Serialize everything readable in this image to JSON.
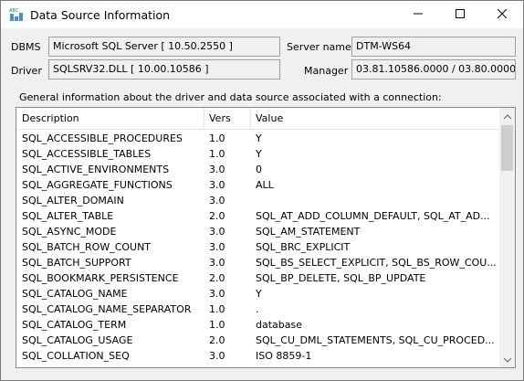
{
  "window": {
    "title": "Data Source Information"
  },
  "info": {
    "dbms_label": "DBMS",
    "dbms_value": "Microsoft SQL Server [ 10.50.2550 ]",
    "driver_label": "Driver",
    "driver_value": "SQLSRV32.DLL [ 10.00.10586 ]",
    "server_label": "Server name",
    "server_value": "DTM-WS64",
    "manager_label": "Manager",
    "manager_value": "03.81.10586.0000 / 03.80.0000"
  },
  "description": "General information about the driver and data source associated with a connection:",
  "list": {
    "columns": [
      "Description",
      "Vers",
      "Value"
    ],
    "rows": [
      [
        "SQL_ACCESSIBLE_PROCEDURES",
        "1.0",
        "Y"
      ],
      [
        "SQL_ACCESSIBLE_TABLES",
        "1.0",
        "Y"
      ],
      [
        "SQL_ACTIVE_ENVIRONMENTS",
        "3.0",
        "0"
      ],
      [
        "SQL_AGGREGATE_FUNCTIONS",
        "3.0",
        "ALL"
      ],
      [
        "SQL_ALTER_DOMAIN",
        "3.0",
        ""
      ],
      [
        "SQL_ALTER_TABLE",
        "2.0",
        "SQL_AT_ADD_COLUMN_DEFAULT, SQL_AT_AD..."
      ],
      [
        "SQL_ASYNC_MODE",
        "3.0",
        "SQL_AM_STATEMENT"
      ],
      [
        "SQL_BATCH_ROW_COUNT",
        "3.0",
        "SQL_BRC_EXPLICIT"
      ],
      [
        "SQL_BATCH_SUPPORT",
        "3.0",
        "SQL_BS_SELECT_EXPLICIT, SQL_BS_ROW_COU..."
      ],
      [
        "SQL_BOOKMARK_PERSISTENCE",
        "2.0",
        "SQL_BP_DELETE, SQL_BP_UPDATE"
      ],
      [
        "SQL_CATALOG_NAME",
        "3.0",
        "Y"
      ],
      [
        "SQL_CATALOG_NAME_SEPARATOR",
        "1.0",
        "."
      ],
      [
        "SQL_CATALOG_TERM",
        "1.0",
        "database"
      ],
      [
        "SQL_CATALOG_USAGE",
        "2.0",
        "SQL_CU_DML_STATEMENTS, SQL_CU_PROCED..."
      ],
      [
        "SQL_COLLATION_SEQ",
        "3.0",
        "ISO 8859-1"
      ]
    ]
  },
  "icons": {
    "app": "data-source-icon",
    "minimize": "minimize-icon",
    "maximize": "maximize-icon",
    "close": "close-icon",
    "scroll_up": "scroll-up-icon",
    "scroll_down": "scroll-down-icon"
  }
}
